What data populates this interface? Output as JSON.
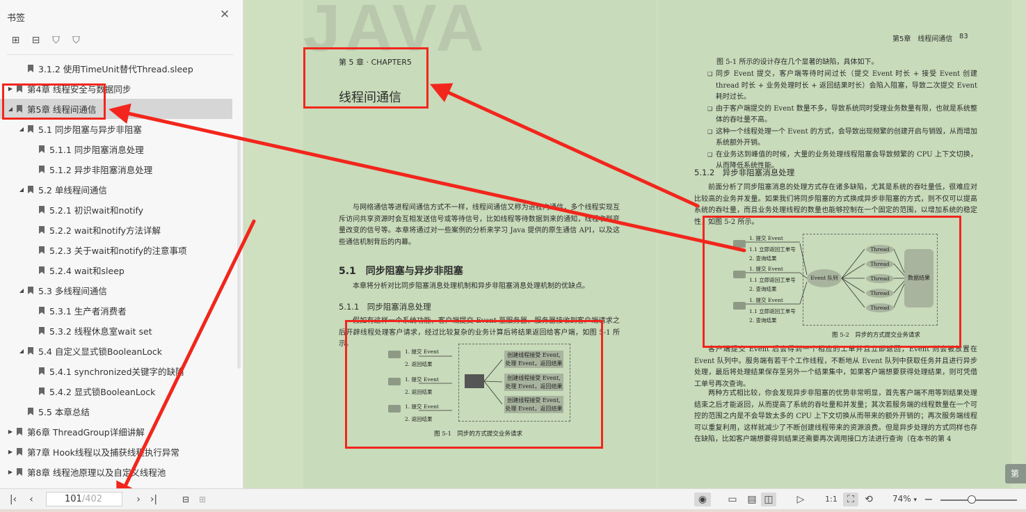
{
  "sidebar": {
    "title": "书签",
    "close_icon": "✕",
    "tools": [
      "add-bookmark-icon",
      "remove-bookmark-icon",
      "bookmark-icon",
      "bookmark-outline-icon"
    ],
    "items": [
      {
        "label": "3.1.2 使用TimeUnit替代Thread.sleep",
        "level": 1,
        "expander": ""
      },
      {
        "label": "第4章 线程安全与数据同步",
        "level": 0,
        "expander": "▶"
      },
      {
        "label": "第5章 线程间通信",
        "level": 0,
        "expander": "◢",
        "selected": true
      },
      {
        "label": "5.1 同步阻塞与异步非阻塞",
        "level": 1,
        "expander": "◢"
      },
      {
        "label": "5.1.1 同步阻塞消息处理",
        "level": 2,
        "expander": ""
      },
      {
        "label": "5.1.2 异步非阻塞消息处理",
        "level": 2,
        "expander": ""
      },
      {
        "label": "5.2 单线程间通信",
        "level": 1,
        "expander": "◢"
      },
      {
        "label": "5.2.1 初识wait和notify",
        "level": 2,
        "expander": ""
      },
      {
        "label": "5.2.2 wait和notify方法详解",
        "level": 2,
        "expander": ""
      },
      {
        "label": "5.2.3 关于wait和notify的注意事项",
        "level": 2,
        "expander": ""
      },
      {
        "label": "5.2.4 wait和sleep",
        "level": 2,
        "expander": ""
      },
      {
        "label": "5.3 多线程间通信",
        "level": 1,
        "expander": "◢"
      },
      {
        "label": "5.3.1 生产者消费者",
        "level": 2,
        "expander": ""
      },
      {
        "label": "5.3.2 线程休息室wait set",
        "level": 2,
        "expander": ""
      },
      {
        "label": "5.4 自定义显式锁BooleanLock",
        "level": 1,
        "expander": "◢"
      },
      {
        "label": "5.4.1 synchronized关键字的缺陷",
        "level": 2,
        "expander": ""
      },
      {
        "label": "5.4.2 显式锁BooleanLock",
        "level": 2,
        "expander": ""
      },
      {
        "label": "5.5 本章总结",
        "level": 1,
        "expander": ""
      },
      {
        "label": "第6章 ThreadGroup详细讲解",
        "level": 0,
        "expander": "▶"
      },
      {
        "label": "第7章 Hook线程以及捕获线程执行异常",
        "level": 0,
        "expander": "▶"
      },
      {
        "label": "第8章 线程池原理以及自定义线程池",
        "level": 0,
        "expander": "▶"
      }
    ]
  },
  "left_page": {
    "watermark": "JAVA",
    "chapter_label": "第 5 章 · CHAPTER5",
    "chapter_title": "线程间通信",
    "intro": "与网络通信等进程间通信方式不一样，线程间通信又称为进程内通信，多个线程实现互斥访问共享资源时会互相发送信号或等待信号，比如线程等待数据到来的通知，线程收到变量改变的信号等。本章将通过对一些案例的分析来学习 Java 提供的原生通信 API，以及这些通信机制背后的内幕。",
    "section": "5.1　同步阻塞与异步非阻塞",
    "section_intro": "本章将分析对比同步阻塞消息处理机制和异步非阻塞消息处理机制的优缺点。",
    "subsection": "5.1.1　同步阻塞消息处理",
    "subsection_para": "假如有这样一个系统功能，客户端提交 Event 至服务器，服务器接收到客户端请求之后开辟线程处理客户请求，经过比较复杂的业务计算后将结果返回给客户端，如图 5-1 所示。",
    "figure": {
      "submit": "1. 提交 Event",
      "return": "2. 返回结果",
      "box_line1": "创建线程接受 Event,",
      "box_line2": "处理 Event，返回结果",
      "caption": "图 5-1　同步的方式提交业务请求"
    }
  },
  "right_page": {
    "header": "第5章　线程间通信",
    "page_number": "83",
    "p1": "图 5-1 所示的设计存在几个显著的缺陷，具体如下。",
    "bullets": [
      "同步 Event 提交，客户端等待时间过长（提交 Event 时长 + 接受 Event 创建 thread 时长 + 业务处理时长 + 返回结果时长）会陷入阻塞，导致二次提交 Event 耗时过长。",
      "由于客户端提交的 Event 数量不多，导致系统同时受理业务数量有限，也就是系统整体的吞吐量不高。",
      "这种一个线程处理一个 Event 的方式，会导致出现频繁的创建开启与销毁，从而增加系统额外开销。",
      "在业务达到峰值的时候，大量的业务处理线程阻塞会导致频繁的 CPU 上下文切换，从而降低系统性能。"
    ],
    "subsection": "5.1.2　异步非阻塞消息处理",
    "p2": "前面分析了同步阻塞消息的处理方式存在诸多缺陷，尤其是系统的吞吐量低，很难应对比较高的业务并发量。如果我们将同步阻塞的方式换成异步非阻塞的方式，则不仅可以提高系统的吞吐量，而且业务处理线程的数量也能够控制在一个固定的范围，以增加系统的稳定性，如图 5-2 所示。",
    "figure": {
      "submit": "1. 提交 Event",
      "ack": "1.1 立即返回工单号",
      "query": "2. 查询结果",
      "queue": "Event 队列",
      "thread": "Thread",
      "db": "数据结果",
      "caption": "图 5-2　异步的方式提交业务请求"
    },
    "p3": "客户端提交 Event 后会得到一个相应的工单并且立即返回，Event 则会被放置在 Event 队列中。服务端有若干个工作线程，不断地从 Event 队列中获取任务并且进行异步处理，最后将处理结果保存至另外一个结果集中，如果客户端想要获得处理结果，则可凭借工单号再次查询。",
    "p4": "两种方式相比较，你会发现异步非阻塞的优势非常明显，首先客户端不用等到结果处理结束之后才能返回，从而提高了系统的吞吐量和并发量；其次若服务端的线程数量在一个可控的范围之内是不会导致太多的 CPU 上下文切换从而带来的额外开销的；再次服务端线程可以重复利用，这样就减少了不断创建线程带来的资源浪费。但是异步处理的方式同样也存在缺陷，比如客户端想要得到结果还需要再次调用接口方法进行查询（在本书的第 4"
  },
  "next_badge": "第",
  "bottom_bar": {
    "current_page": "101",
    "total_pages": "/402",
    "zoom": "74%",
    "zoom_caret": "▾",
    "zoom_level": 0.41,
    "icons": [
      "first-page-icon",
      "prev-page-icon",
      "next-page-icon",
      "last-page-icon",
      "back-icon",
      "forward-icon",
      "eye-icon",
      "single-page-icon",
      "doc-icon",
      "double-page-icon",
      "play-icon",
      "actual-size-icon",
      "fit-page-icon",
      "rotate-icon",
      "zoom-out-icon"
    ]
  },
  "colors": {
    "highlight": "#f2261c",
    "page_bg": "#c8dbba",
    "selected_item": "#d6d6d6"
  }
}
